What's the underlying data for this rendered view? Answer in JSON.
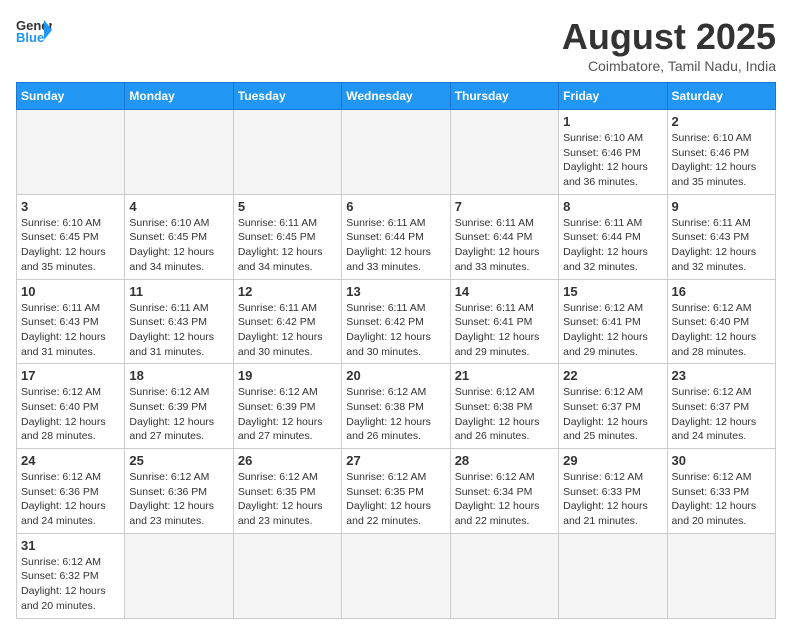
{
  "header": {
    "logo_general": "General",
    "logo_blue": "Blue",
    "month_title": "August 2025",
    "subtitle": "Coimbatore, Tamil Nadu, India"
  },
  "weekdays": [
    "Sunday",
    "Monday",
    "Tuesday",
    "Wednesday",
    "Thursday",
    "Friday",
    "Saturday"
  ],
  "weeks": [
    [
      {
        "day": "",
        "info": ""
      },
      {
        "day": "",
        "info": ""
      },
      {
        "day": "",
        "info": ""
      },
      {
        "day": "",
        "info": ""
      },
      {
        "day": "",
        "info": ""
      },
      {
        "day": "1",
        "info": "Sunrise: 6:10 AM\nSunset: 6:46 PM\nDaylight: 12 hours and 36 minutes."
      },
      {
        "day": "2",
        "info": "Sunrise: 6:10 AM\nSunset: 6:46 PM\nDaylight: 12 hours and 35 minutes."
      }
    ],
    [
      {
        "day": "3",
        "info": "Sunrise: 6:10 AM\nSunset: 6:45 PM\nDaylight: 12 hours and 35 minutes."
      },
      {
        "day": "4",
        "info": "Sunrise: 6:10 AM\nSunset: 6:45 PM\nDaylight: 12 hours and 34 minutes."
      },
      {
        "day": "5",
        "info": "Sunrise: 6:11 AM\nSunset: 6:45 PM\nDaylight: 12 hours and 34 minutes."
      },
      {
        "day": "6",
        "info": "Sunrise: 6:11 AM\nSunset: 6:44 PM\nDaylight: 12 hours and 33 minutes."
      },
      {
        "day": "7",
        "info": "Sunrise: 6:11 AM\nSunset: 6:44 PM\nDaylight: 12 hours and 33 minutes."
      },
      {
        "day": "8",
        "info": "Sunrise: 6:11 AM\nSunset: 6:44 PM\nDaylight: 12 hours and 32 minutes."
      },
      {
        "day": "9",
        "info": "Sunrise: 6:11 AM\nSunset: 6:43 PM\nDaylight: 12 hours and 32 minutes."
      }
    ],
    [
      {
        "day": "10",
        "info": "Sunrise: 6:11 AM\nSunset: 6:43 PM\nDaylight: 12 hours and 31 minutes."
      },
      {
        "day": "11",
        "info": "Sunrise: 6:11 AM\nSunset: 6:43 PM\nDaylight: 12 hours and 31 minutes."
      },
      {
        "day": "12",
        "info": "Sunrise: 6:11 AM\nSunset: 6:42 PM\nDaylight: 12 hours and 30 minutes."
      },
      {
        "day": "13",
        "info": "Sunrise: 6:11 AM\nSunset: 6:42 PM\nDaylight: 12 hours and 30 minutes."
      },
      {
        "day": "14",
        "info": "Sunrise: 6:11 AM\nSunset: 6:41 PM\nDaylight: 12 hours and 29 minutes."
      },
      {
        "day": "15",
        "info": "Sunrise: 6:12 AM\nSunset: 6:41 PM\nDaylight: 12 hours and 29 minutes."
      },
      {
        "day": "16",
        "info": "Sunrise: 6:12 AM\nSunset: 6:40 PM\nDaylight: 12 hours and 28 minutes."
      }
    ],
    [
      {
        "day": "17",
        "info": "Sunrise: 6:12 AM\nSunset: 6:40 PM\nDaylight: 12 hours and 28 minutes."
      },
      {
        "day": "18",
        "info": "Sunrise: 6:12 AM\nSunset: 6:39 PM\nDaylight: 12 hours and 27 minutes."
      },
      {
        "day": "19",
        "info": "Sunrise: 6:12 AM\nSunset: 6:39 PM\nDaylight: 12 hours and 27 minutes."
      },
      {
        "day": "20",
        "info": "Sunrise: 6:12 AM\nSunset: 6:38 PM\nDaylight: 12 hours and 26 minutes."
      },
      {
        "day": "21",
        "info": "Sunrise: 6:12 AM\nSunset: 6:38 PM\nDaylight: 12 hours and 26 minutes."
      },
      {
        "day": "22",
        "info": "Sunrise: 6:12 AM\nSunset: 6:37 PM\nDaylight: 12 hours and 25 minutes."
      },
      {
        "day": "23",
        "info": "Sunrise: 6:12 AM\nSunset: 6:37 PM\nDaylight: 12 hours and 24 minutes."
      }
    ],
    [
      {
        "day": "24",
        "info": "Sunrise: 6:12 AM\nSunset: 6:36 PM\nDaylight: 12 hours and 24 minutes."
      },
      {
        "day": "25",
        "info": "Sunrise: 6:12 AM\nSunset: 6:36 PM\nDaylight: 12 hours and 23 minutes."
      },
      {
        "day": "26",
        "info": "Sunrise: 6:12 AM\nSunset: 6:35 PM\nDaylight: 12 hours and 23 minutes."
      },
      {
        "day": "27",
        "info": "Sunrise: 6:12 AM\nSunset: 6:35 PM\nDaylight: 12 hours and 22 minutes."
      },
      {
        "day": "28",
        "info": "Sunrise: 6:12 AM\nSunset: 6:34 PM\nDaylight: 12 hours and 22 minutes."
      },
      {
        "day": "29",
        "info": "Sunrise: 6:12 AM\nSunset: 6:33 PM\nDaylight: 12 hours and 21 minutes."
      },
      {
        "day": "30",
        "info": "Sunrise: 6:12 AM\nSunset: 6:33 PM\nDaylight: 12 hours and 20 minutes."
      }
    ],
    [
      {
        "day": "31",
        "info": "Sunrise: 6:12 AM\nSunset: 6:32 PM\nDaylight: 12 hours and 20 minutes."
      },
      {
        "day": "",
        "info": ""
      },
      {
        "day": "",
        "info": ""
      },
      {
        "day": "",
        "info": ""
      },
      {
        "day": "",
        "info": ""
      },
      {
        "day": "",
        "info": ""
      },
      {
        "day": "",
        "info": ""
      }
    ]
  ]
}
